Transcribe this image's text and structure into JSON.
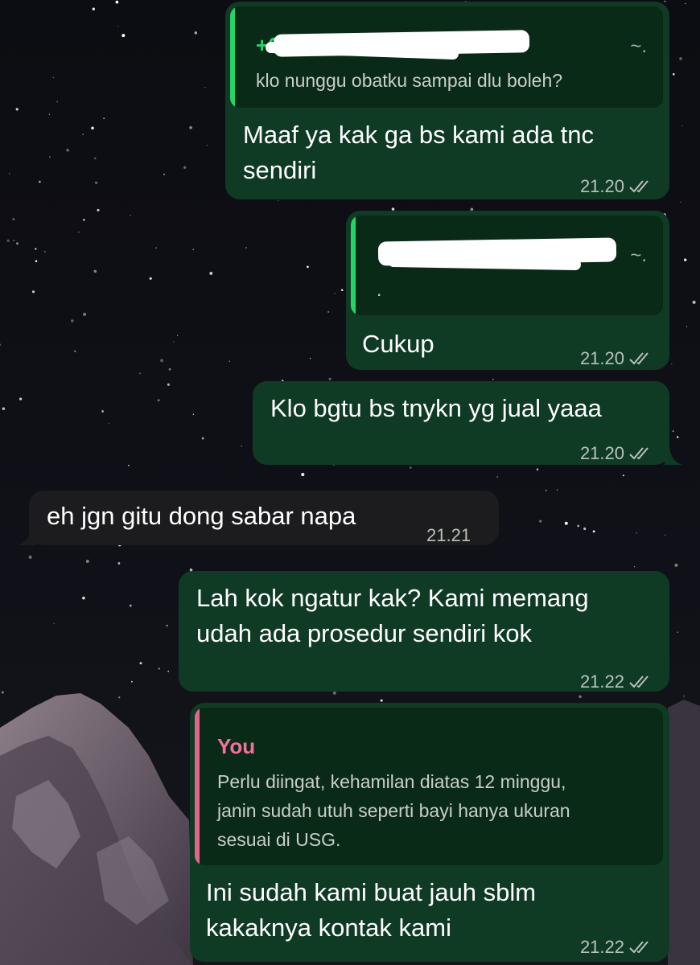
{
  "messages": [
    {
      "direction": "outgoing",
      "quote": {
        "sender": "+6",
        "sender_redacted": true,
        "text": "klo nunggu obatku sampai dlu boleh?",
        "marker": "~."
      },
      "text": "Maaf ya kak ga bs kami ada tnc\nsendiri",
      "time": "21.20",
      "status_icon": "double-check-icon"
    },
    {
      "direction": "outgoing",
      "quote": {
        "sender": "",
        "sender_redacted": true,
        "text": ".",
        "marker": "~."
      },
      "text": "Cukup",
      "time": "21.20",
      "status_icon": "double-check-icon"
    },
    {
      "direction": "outgoing",
      "text": "Klo bgtu bs tnykn yg jual yaaa",
      "time": "21.20",
      "status_icon": "double-check-icon"
    },
    {
      "direction": "incoming",
      "text": "eh jgn gitu dong sabar napa",
      "time": "21.21"
    },
    {
      "direction": "outgoing",
      "text": "Lah kok ngatur kak? Kami memang\nudah ada prosedur sendiri kok",
      "time": "21.22",
      "status_icon": "double-check-icon"
    },
    {
      "direction": "outgoing",
      "quote": {
        "sender": "You",
        "text": "Perlu diingat, kehamilan diatas 12 minggu,\njanin sudah utuh seperti bayi hanya ukuran\nsesuai di USG."
      },
      "text": "Ini sudah kami buat jauh sblm\nkakaknya kontak kami",
      "time": "21.22",
      "status_icon": "double-check-icon"
    }
  ],
  "colors": {
    "outgoing_bubble": "#0f3b24",
    "incoming_bubble": "#1c1c1e",
    "quote_background": "#0a2a18",
    "quote_bar_contact": "#25d366",
    "quote_bar_you": "#e0668e",
    "quote_name_you": "#f2719d",
    "read_ticks": "#b9c2b9"
  }
}
